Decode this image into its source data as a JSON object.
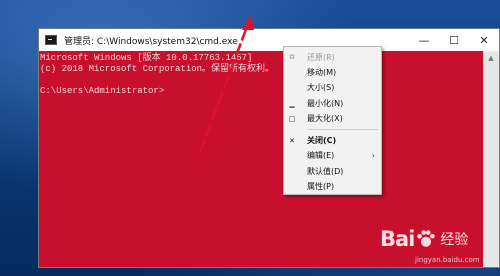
{
  "window": {
    "title": "管理员: C:\\Windows\\system32\\cmd.exe",
    "buttons": {
      "minimize": "—",
      "maximize": "☐",
      "close": "✕"
    }
  },
  "console": {
    "lines": [
      "Microsoft Windows [版本 10.0.17763.1457]",
      "(c) 2018 Microsoft Corporation。保留所有权利。",
      "",
      "C:\\Users\\Administrator>"
    ]
  },
  "context_menu": {
    "items": [
      {
        "label": "还原(R)",
        "icon": "restore-icon",
        "glyph": "⧉",
        "disabled": true
      },
      {
        "label": "移动(M)",
        "icon": "",
        "glyph": "",
        "disabled": false
      },
      {
        "label": "大小(S)",
        "icon": "",
        "glyph": "",
        "disabled": false
      },
      {
        "label": "最小化(N)",
        "icon": "minimize-icon",
        "glyph": "▁",
        "disabled": false
      },
      {
        "label": "最大化(X)",
        "icon": "maximize-icon",
        "glyph": "□",
        "disabled": false
      },
      {
        "label": "关闭(C)",
        "icon": "close-icon",
        "glyph": "✕",
        "disabled": false,
        "bold": true
      },
      {
        "label": "编辑(E)",
        "icon": "",
        "glyph": "",
        "disabled": false,
        "submenu": "›"
      },
      {
        "label": "默认值(D)",
        "icon": "",
        "glyph": "",
        "disabled": false
      },
      {
        "label": "属性(P)",
        "icon": "",
        "glyph": "",
        "disabled": false
      }
    ]
  },
  "watermark": {
    "brand_left": "Bai",
    "brand_right": "经验",
    "url": "jingyan.baidu.com"
  },
  "colors": {
    "console_bg": "#c8102e",
    "arrow": "#e0102a"
  }
}
